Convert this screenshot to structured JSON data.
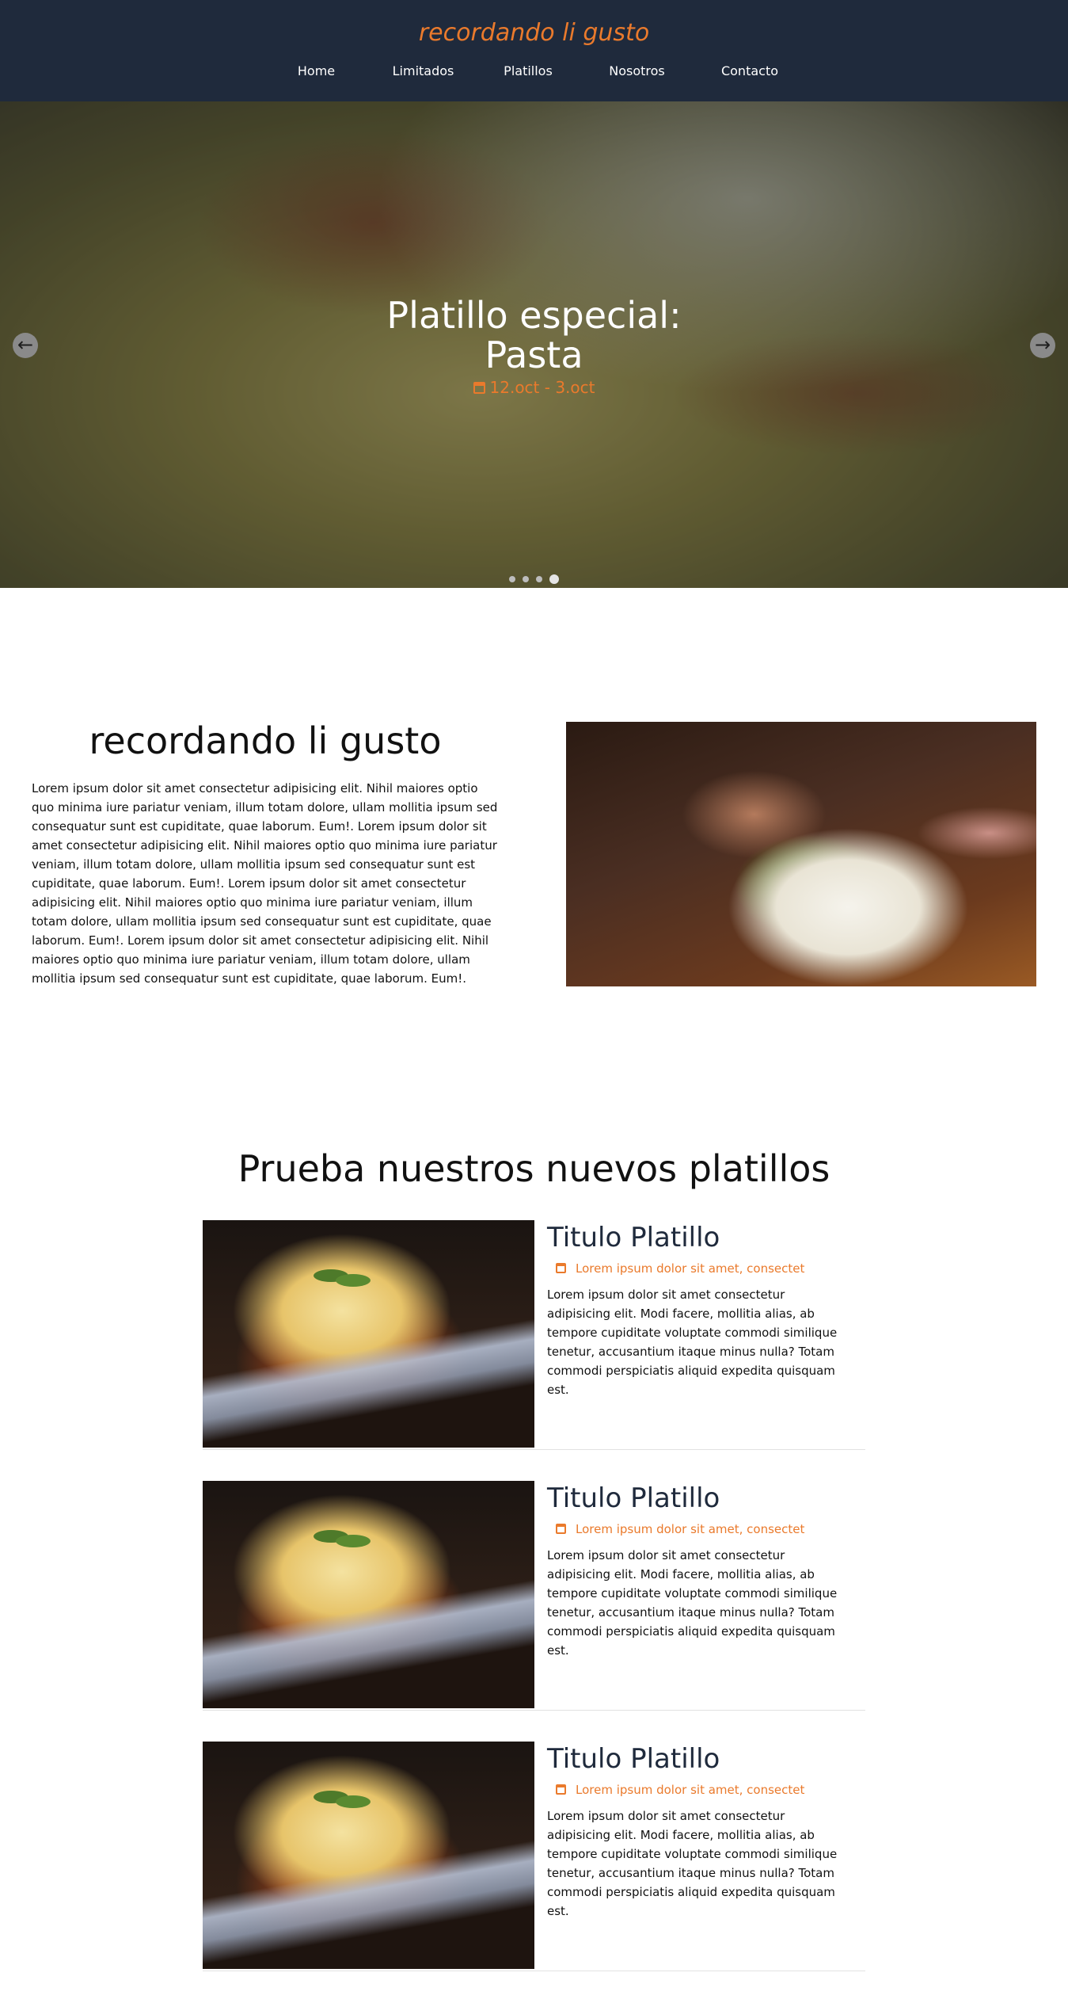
{
  "header": {
    "brand": "recordando li gusto",
    "nav": [
      "Home",
      "Limitados",
      "Platillos",
      "Nosotros",
      "Contacto"
    ]
  },
  "hero": {
    "title_line1": "Platillo especial:",
    "title_line2": "Pasta",
    "date": "12.oct - 3.oct",
    "prev_icon": "arrow-left-icon",
    "next_icon": "arrow-right-icon",
    "slides_count": 4,
    "active_slide": 4
  },
  "about": {
    "title": "recordando li gusto",
    "text": "Lorem ipsum dolor sit amet consectetur adipisicing elit. Nihil maiores optio quo minima iure pariatur veniam, illum totam dolore, ullam mollitia ipsum sed consequatur sunt est cupiditate, quae laborum. Eum!. Lorem ipsum dolor sit amet consectetur adipisicing elit. Nihil maiores optio quo minima iure pariatur veniam, illum totam dolore, ullam mollitia ipsum sed consequatur sunt est cupiditate, quae laborum. Eum!. Lorem ipsum dolor sit amet consectetur adipisicing elit. Nihil maiores optio quo minima iure pariatur veniam, illum totam dolore, ullam mollitia ipsum sed consequatur sunt est cupiditate, quae laborum. Eum!. Lorem ipsum dolor sit amet consectetur adipisicing elit. Nihil maiores optio quo minima iure pariatur veniam, illum totam dolore, ullam mollitia ipsum sed consequatur sunt est cupiditate, quae laborum. Eum!."
  },
  "dishes": {
    "title": "Prueba nuestros nuevos platillos",
    "items": [
      {
        "title": "Titulo Platillo",
        "meta": "Lorem ipsum dolor sit amet, consectet",
        "text": "Lorem ipsum dolor sit amet consectetur adipisicing elit. Modi facere, mollitia alias, ab tempore cupiditate voluptate commodi similique tenetur, accusantium itaque minus nulla? Totam commodi perspiciatis aliquid expedita quisquam est."
      },
      {
        "title": "Titulo Platillo",
        "meta": "Lorem ipsum dolor sit amet, consectet",
        "text": "Lorem ipsum dolor sit amet consectetur adipisicing elit. Modi facere, mollitia alias, ab tempore cupiditate voluptate commodi similique tenetur, accusantium itaque minus nulla? Totam commodi perspiciatis aliquid expedita quisquam est."
      },
      {
        "title": "Titulo Platillo",
        "meta": "Lorem ipsum dolor sit amet, consectet",
        "text": "Lorem ipsum dolor sit amet consectetur adipisicing elit. Modi facere, mollitia alias, ab tempore cupiditate voluptate commodi similique tenetur, accusantium itaque minus nulla? Totam commodi perspiciatis aliquid expedita quisquam est."
      }
    ]
  },
  "colors": {
    "header_bg": "#1f2a3c",
    "accent": "#ea7a2c",
    "dish_title": "#1f2a3c"
  }
}
